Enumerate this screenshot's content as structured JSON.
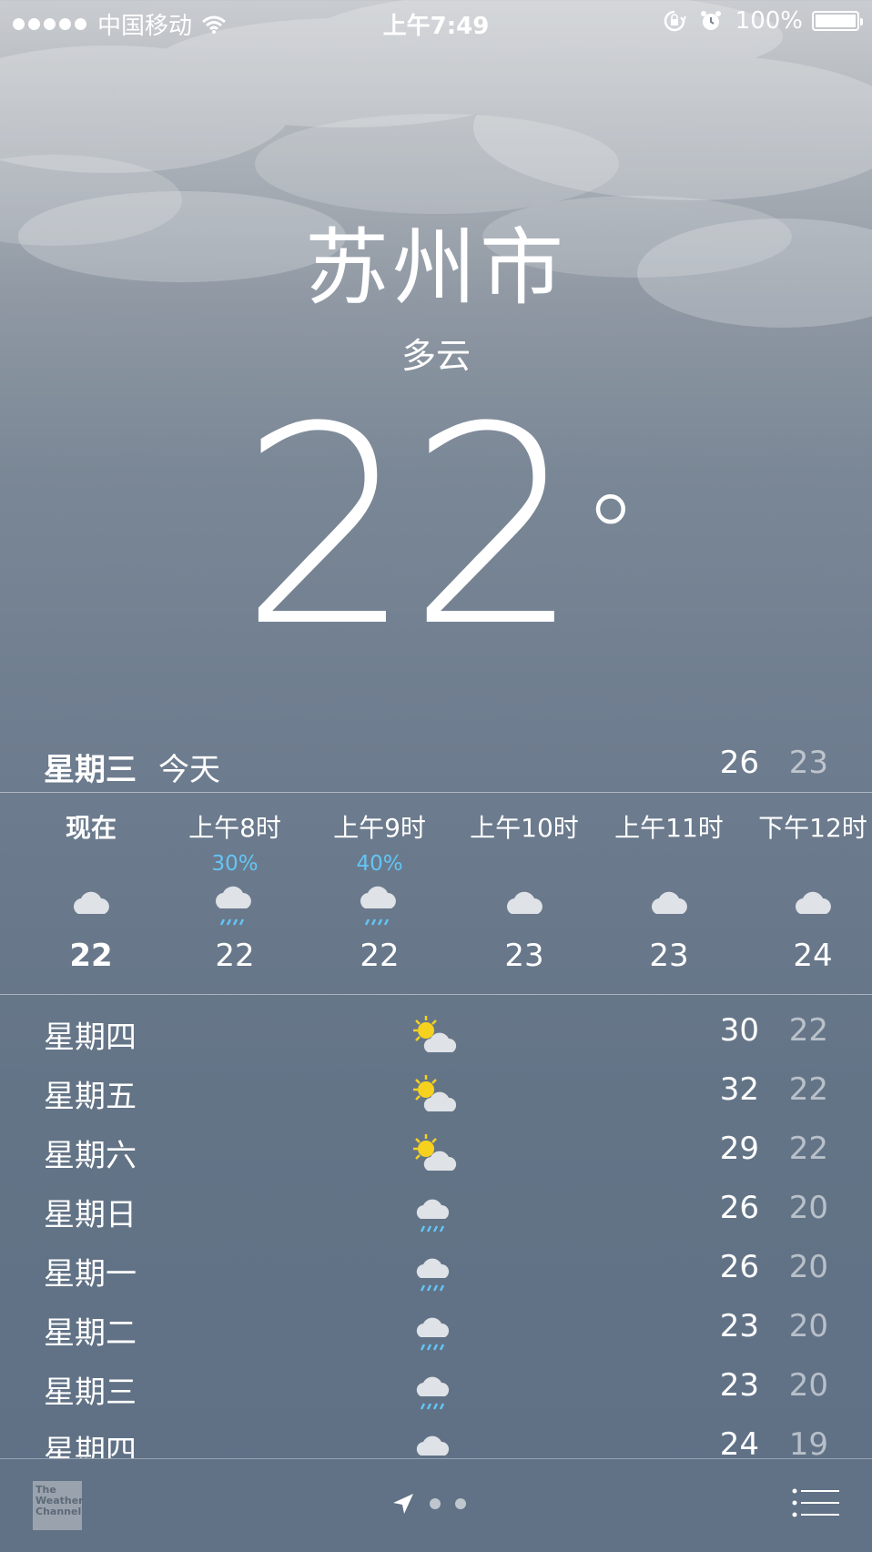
{
  "status_bar": {
    "carrier": "中国移动",
    "time": "上午7:49",
    "battery": "100%",
    "signal_dots": 5,
    "icons": [
      "wifi-icon",
      "rotation-lock-icon",
      "alarm-icon",
      "battery-icon"
    ]
  },
  "location": {
    "city": "苏州市",
    "condition": "多云",
    "temperature": "22",
    "degree_symbol": "°"
  },
  "today": {
    "day": "星期三",
    "label": "今天",
    "high": "26",
    "low": "23"
  },
  "hourly": [
    {
      "time": "现在",
      "precip": "",
      "icon": "cloud-icon",
      "temp": "22"
    },
    {
      "time": "上午8时",
      "precip": "30%",
      "icon": "rain-icon",
      "temp": "22"
    },
    {
      "time": "上午9时",
      "precip": "40%",
      "icon": "rain-icon",
      "temp": "22"
    },
    {
      "time": "上午10时",
      "precip": "",
      "icon": "cloud-icon",
      "temp": "23"
    },
    {
      "time": "上午11时",
      "precip": "",
      "icon": "cloud-icon",
      "temp": "23"
    },
    {
      "time": "下午12时",
      "precip": "",
      "icon": "cloud-icon",
      "temp": "24"
    }
  ],
  "daily": [
    {
      "day": "星期四",
      "icon": "partly-sunny-icon",
      "high": "30",
      "low": "22"
    },
    {
      "day": "星期五",
      "icon": "partly-sunny-icon",
      "high": "32",
      "low": "22"
    },
    {
      "day": "星期六",
      "icon": "partly-sunny-icon",
      "high": "29",
      "low": "22"
    },
    {
      "day": "星期日",
      "icon": "rain-icon",
      "high": "26",
      "low": "20"
    },
    {
      "day": "星期一",
      "icon": "rain-icon",
      "high": "26",
      "low": "20"
    },
    {
      "day": "星期二",
      "icon": "rain-icon",
      "high": "23",
      "low": "20"
    },
    {
      "day": "星期三",
      "icon": "rain-icon",
      "high": "23",
      "low": "20"
    },
    {
      "day": "星期四",
      "icon": "rain-icon",
      "high": "24",
      "low": "19"
    }
  ],
  "toolbar": {
    "logo_text": "The Weather Channel",
    "pages": 2,
    "icons": [
      "location-arrow-icon",
      "list-icon"
    ]
  },
  "colors": {
    "precip": "#63c5f5",
    "sun": "#f6d21f",
    "cloud": "#dfe2e6"
  }
}
